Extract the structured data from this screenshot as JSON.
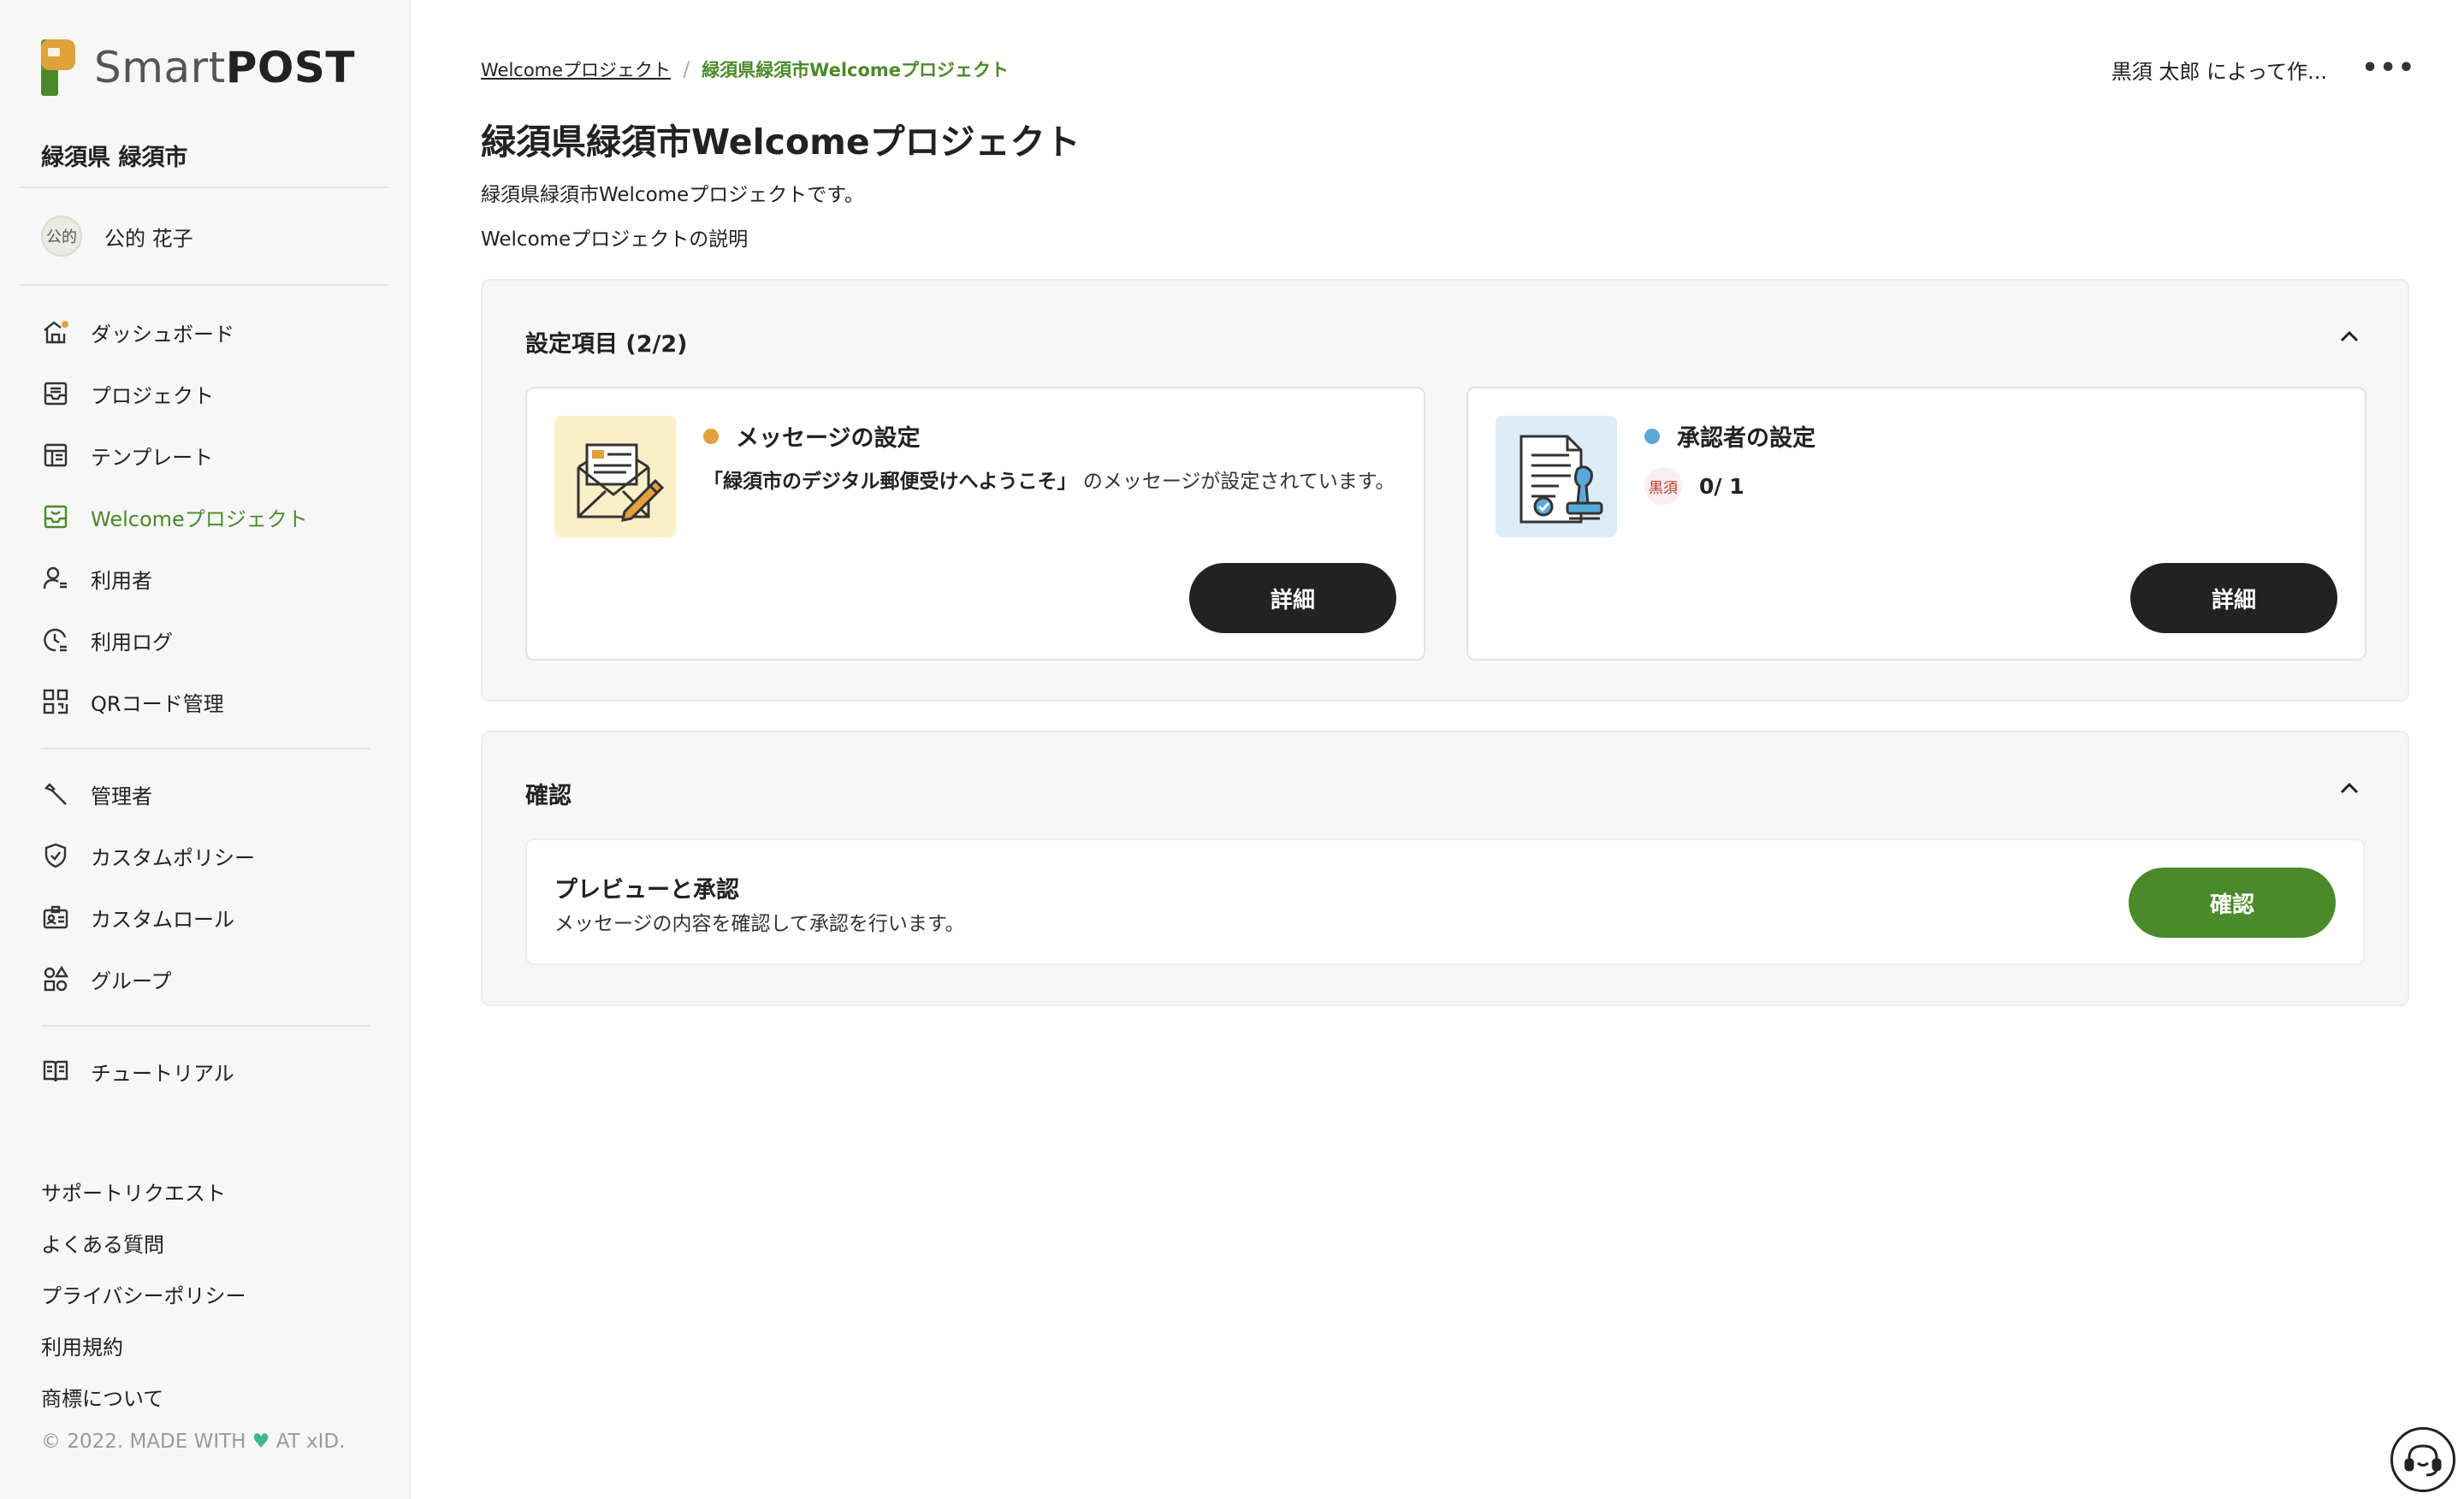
{
  "brand": {
    "logo_light": "Smart",
    "logo_bold": "POST",
    "colors": {
      "accent_green": "#4a8a2a",
      "dark": "#222222",
      "orange": "#e0a23a",
      "blue": "#5aa9d8"
    }
  },
  "sidebar": {
    "org_name": "緑須県 緑須市",
    "user": {
      "avatar_text": "公的",
      "name": "公的 花子"
    },
    "nav_main": [
      {
        "label": "ダッシュボード",
        "icon": "home-icon"
      },
      {
        "label": "プロジェクト",
        "icon": "inbox-icon"
      },
      {
        "label": "テンプレート",
        "icon": "template-icon"
      },
      {
        "label": "Welcomeプロジェクト",
        "icon": "welcome-inbox-icon",
        "active": true
      },
      {
        "label": "利用者",
        "icon": "users-icon"
      },
      {
        "label": "利用ログ",
        "icon": "clock-log-icon"
      },
      {
        "label": "QRコード管理",
        "icon": "qr-icon"
      }
    ],
    "nav_admin": [
      {
        "label": "管理者",
        "icon": "wrench-icon"
      },
      {
        "label": "カスタムポリシー",
        "icon": "shield-icon"
      },
      {
        "label": "カスタムロール",
        "icon": "id-card-icon"
      },
      {
        "label": "グループ",
        "icon": "shapes-icon"
      }
    ],
    "nav_help": [
      {
        "label": "チュートリアル",
        "icon": "book-icon"
      }
    ],
    "footer_links": [
      "サポートリクエスト",
      "よくある質問",
      "プライバシーポリシー",
      "利用規約",
      "商標について"
    ],
    "copyright_before": "© 2022. MADE WITH",
    "copyright_after": "AT xID."
  },
  "header": {
    "breadcrumb_parent": "Welcomeプロジェクト",
    "breadcrumb_sep": "/",
    "breadcrumb_current": "緑須県緑須市Welcomeプロジェクト",
    "created_by": "黒須 太郎 によって作...",
    "more_label": "•••"
  },
  "page": {
    "title": "緑須県緑須市Welcomeプロジェクト",
    "description": "緑須県緑須市Welcomeプロジェクトです。",
    "description2": "Welcomeプロジェクトの説明"
  },
  "settings": {
    "title": "設定項目 (2/2)",
    "message_card": {
      "title": "メッセージの設定",
      "body_bold": "「緑須市のデジタル郵便受けへようこそ」",
      "body_rest": " のメッセージが設定されています。",
      "button": "詳細"
    },
    "approver_card": {
      "title": "承認者の設定",
      "stamp": "黒須",
      "count": "0/ 1",
      "button": "詳細"
    }
  },
  "confirm": {
    "title": "確認",
    "card_title": "プレビューと承認",
    "card_sub": "メッセージの内容を確認して承認を行います。",
    "button": "確認"
  }
}
